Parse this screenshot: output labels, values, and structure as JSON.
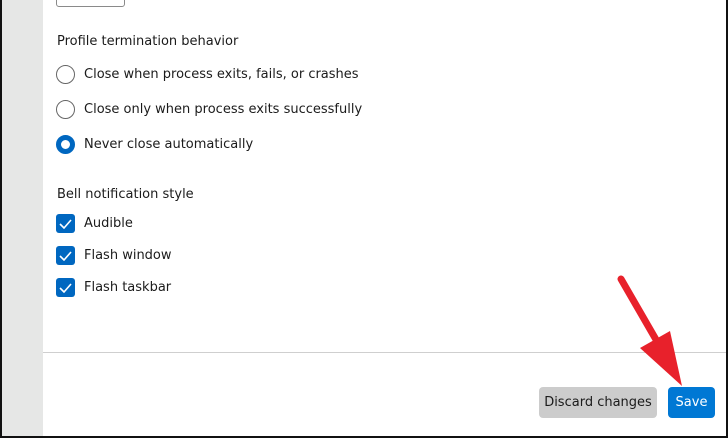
{
  "termination": {
    "label": "Profile termination behavior",
    "options": [
      {
        "label": "Close when process exits, fails, or crashes",
        "selected": false
      },
      {
        "label": "Close only when process exits successfully",
        "selected": false
      },
      {
        "label": "Never close automatically",
        "selected": true
      }
    ]
  },
  "bell": {
    "label": "Bell notification style",
    "options": [
      {
        "label": "Audible",
        "checked": true
      },
      {
        "label": "Flash window",
        "checked": true
      },
      {
        "label": "Flash taskbar",
        "checked": true
      }
    ]
  },
  "footer": {
    "discard_label": "Discard changes",
    "save_label": "Save"
  },
  "colors": {
    "accent": "#0078d4",
    "annotation": "#e8212b"
  }
}
